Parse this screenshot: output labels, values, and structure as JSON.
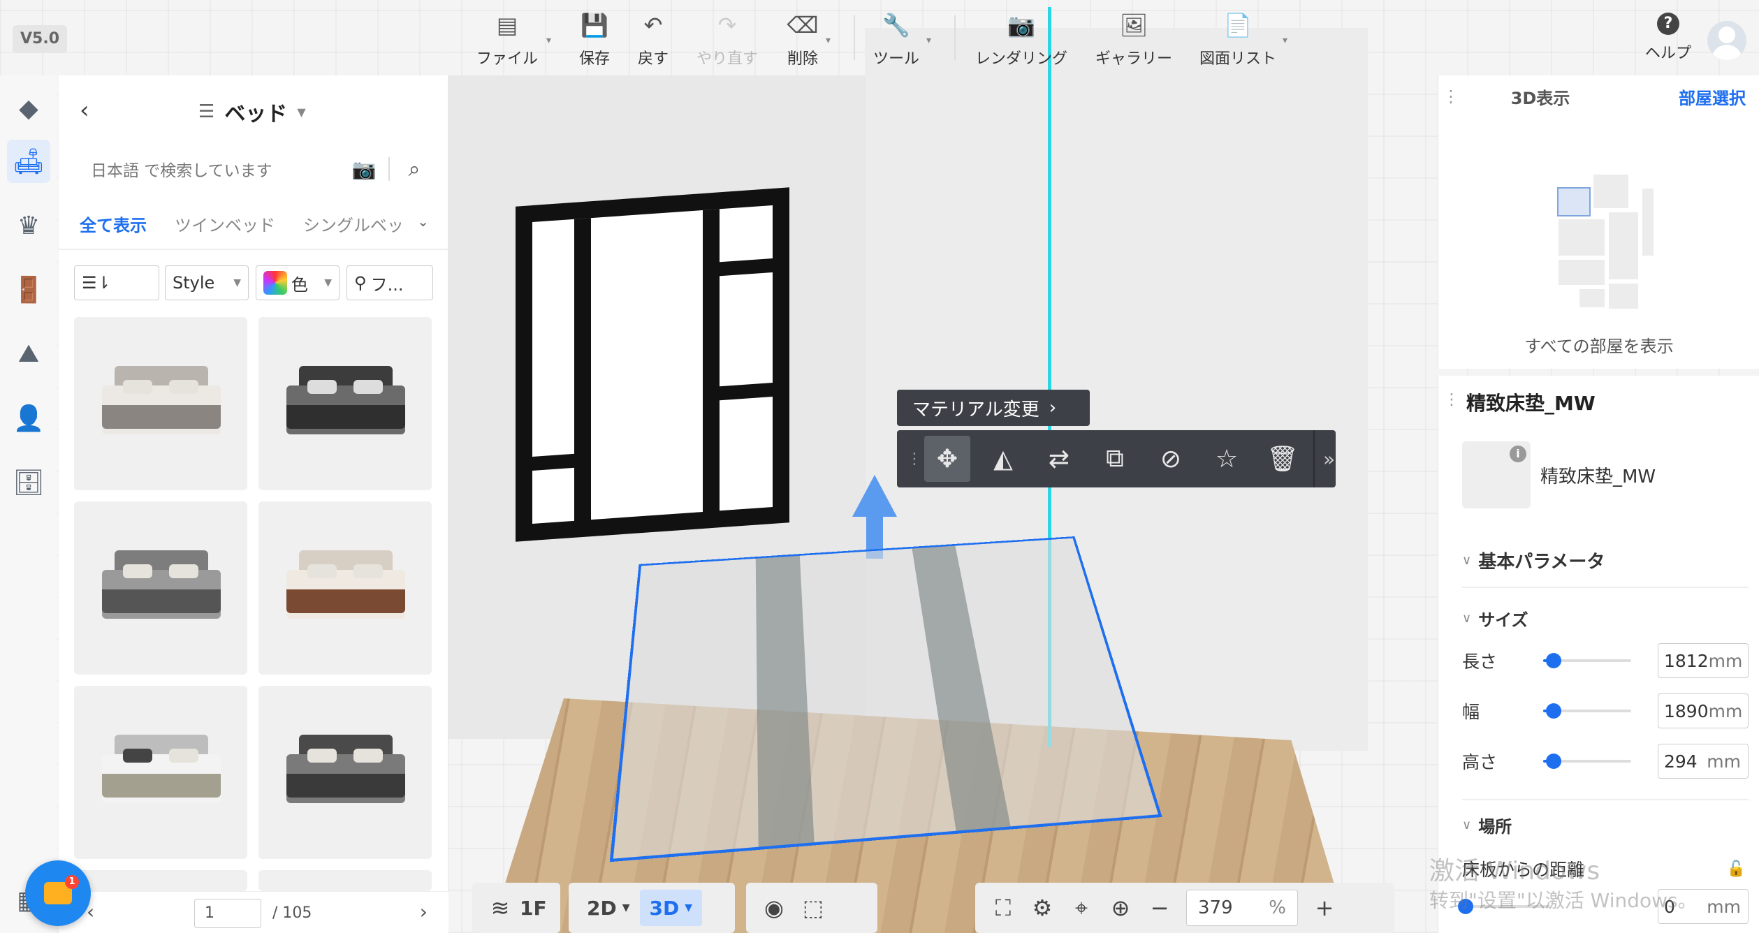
{
  "app": {
    "version": "V5.0"
  },
  "toolbar": {
    "items": [
      {
        "label": "ファイル",
        "icon": "file-icon",
        "glyph": "▤"
      },
      {
        "label": "保存",
        "icon": "save-icon",
        "glyph": "💾"
      },
      {
        "label": "戻す",
        "icon": "undo-icon",
        "glyph": "↶"
      },
      {
        "label": "やり直す",
        "icon": "redo-icon",
        "glyph": "↷"
      },
      {
        "label": "削除",
        "icon": "eraser-icon",
        "glyph": "⌫"
      },
      {
        "label": "ツール",
        "icon": "wrench-icon",
        "glyph": "🔧"
      },
      {
        "label": "レンダリング",
        "icon": "camera-icon",
        "glyph": "📷"
      },
      {
        "label": "ギャラリー",
        "icon": "gallery-icon",
        "glyph": "🖼"
      },
      {
        "label": "図面リスト",
        "icon": "document-icon",
        "glyph": "📄"
      }
    ],
    "help_label": "ヘルプ",
    "help_glyph": "?"
  },
  "catalog": {
    "title": "ベッド",
    "search_placeholder": "日本語 で検索しています",
    "tabs": [
      "全て表示",
      "ツインベッド",
      "シングルベッ"
    ],
    "filters": {
      "sort": "☰⇂",
      "style": "Style",
      "color": "色",
      "more": "フ..."
    },
    "pager": {
      "current": "1",
      "total": "/ 105"
    }
  },
  "floating": {
    "material_tip": "マテリアル変更"
  },
  "right_panel": {
    "view_title": "3D表示",
    "room_select": "部屋選択",
    "show_all_rooms": "すべての部屋を表示",
    "object_name": "精致床垫_MW",
    "object_label": "精致床垫_MW",
    "section_basic": "基本パラメータ",
    "section_size": "サイズ",
    "params": [
      {
        "label": "長さ",
        "value": "1812",
        "unit": "mm",
        "level": 0.12
      },
      {
        "label": "幅",
        "value": "1890",
        "unit": "mm",
        "level": 0.12
      },
      {
        "label": "高さ",
        "value": "294",
        "unit": "mm",
        "level": 0.12
      }
    ],
    "section_location": "場所",
    "floor_distance_label": "床板からの距離",
    "floor_distance_value": "0",
    "floor_distance_unit": "mm"
  },
  "bottom_bar": {
    "floor": "1F",
    "view2d": "2D",
    "view3d": "3D",
    "zoom": "379",
    "zoom_unit": "%"
  },
  "watermark": {
    "line1": "激活 Windows",
    "line2": "转到\"设置\"以激活 Windows。"
  },
  "colors": {
    "accent": "#1e6ff0",
    "selection": "#1e6ff0",
    "outline": "#29d6e6"
  }
}
